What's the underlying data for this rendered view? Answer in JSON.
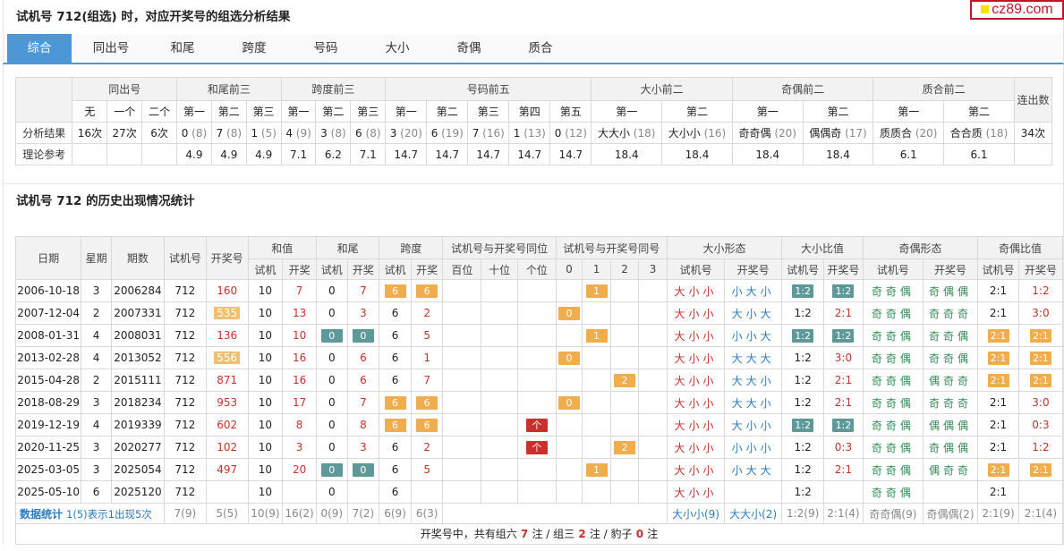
{
  "logo": "cz89.com",
  "section1_title": "试机号 712(组选) 时，对应开奖号的组选分析结果",
  "tabs": [
    "综合",
    "同出号",
    "和尾",
    "跨度",
    "号码",
    "大小",
    "奇偶",
    "质合"
  ],
  "analysis": {
    "groups": [
      "同出号",
      "和尾前三",
      "跨度前三",
      "号码前五",
      "大小前二",
      "奇偶前二",
      "质合前二"
    ],
    "last_col": "连出数",
    "sub": [
      "无",
      "一个",
      "二个",
      "第一",
      "第二",
      "第三",
      "第一",
      "第二",
      "第三",
      "第一",
      "第二",
      "第三",
      "第四",
      "第五",
      "第一",
      "第二",
      "第一",
      "第二",
      "第一",
      "第二"
    ],
    "row1_label": "分析结果",
    "row1": [
      [
        "16次",
        ""
      ],
      [
        "27次",
        ""
      ],
      [
        "6次",
        ""
      ],
      [
        "0",
        "8"
      ],
      [
        "7",
        "8"
      ],
      [
        "1",
        "5"
      ],
      [
        "4",
        "9"
      ],
      [
        "3",
        "8"
      ],
      [
        "6",
        "8"
      ],
      [
        "3",
        "20"
      ],
      [
        "6",
        "19"
      ],
      [
        "7",
        "16"
      ],
      [
        "1",
        "13"
      ],
      [
        "0",
        "12"
      ],
      [
        "大大小",
        "18"
      ],
      [
        "大小小",
        "16"
      ],
      [
        "奇奇偶",
        "20"
      ],
      [
        "偶偶奇",
        "17"
      ],
      [
        "质质合",
        "20"
      ],
      [
        "合合质",
        "18"
      ]
    ],
    "row1_last": "34次",
    "row2_label": "理论参考",
    "row2": [
      "",
      "",
      "",
      "4.9",
      "4.9",
      "4.9",
      "7.1",
      "6.2",
      "7.1",
      "14.7",
      "14.7",
      "14.7",
      "14.7",
      "14.7",
      "18.4",
      "18.4",
      "18.4",
      "18.4",
      "6.1",
      "6.1"
    ],
    "row2_last": ""
  },
  "section2_title": "试机号 712 的历史出现情况统计",
  "history": {
    "top_headers": [
      "日期",
      "星期",
      "期数",
      "试机号",
      "开奖号",
      "和值",
      "和尾",
      "跨度",
      "试机号与开奖号同位",
      "试机号与开奖号同号",
      "大小形态",
      "大小比值",
      "奇偶形态",
      "奇偶比值"
    ],
    "sub_headers": [
      "试机",
      "开奖",
      "试机",
      "开奖",
      "试机",
      "开奖",
      "百位",
      "十位",
      "个位",
      "0",
      "1",
      "2",
      "3",
      "试机号",
      "开奖号",
      "试机号",
      "开奖号",
      "试机号",
      "开奖号",
      "试机号",
      "开奖号"
    ],
    "rows": [
      {
        "date": "2006-10-18",
        "wk": "3",
        "qs": "2006284",
        "sj": "712",
        "kj": "160",
        "kjm": false,
        "hz1": "10",
        "hz2": "7",
        "hw1": "0",
        "hw1m": false,
        "hw2": "7",
        "hw2m": false,
        "kd1": "6",
        "kd1m": true,
        "kd2": "6",
        "kd2m": true,
        "tw": [
          "",
          "",
          ""
        ],
        "th": [
          "",
          "1",
          "",
          ""
        ],
        "dx1": "大小小",
        "dx2": "小大小",
        "bl1": "1:2",
        "bl1m": true,
        "bl2": "1:2",
        "bl2m": true,
        "jo1": "奇奇偶",
        "jo2": "奇偶偶",
        "jb1": "2:1",
        "jb1m": false,
        "jb2": "1:2",
        "jb2m": false
      },
      {
        "date": "2007-12-04",
        "wk": "2",
        "qs": "2007331",
        "sj": "712",
        "kj": "535",
        "kjm": true,
        "hz1": "10",
        "hz2": "13",
        "hw1": "0",
        "hw1m": false,
        "hw2": "3",
        "hw2m": false,
        "kd1": "6",
        "kd1m": false,
        "kd2": "2",
        "kd2m": false,
        "tw": [
          "",
          "",
          ""
        ],
        "th": [
          "0",
          "",
          "",
          ""
        ],
        "dx1": "大小小",
        "dx2": "大小大",
        "bl1": "1:2",
        "bl1m": false,
        "bl2": "2:1",
        "bl2m": false,
        "jo1": "奇奇偶",
        "jo2": "奇奇奇",
        "jb1": "2:1",
        "jb1m": false,
        "jb2": "3:0",
        "jb2m": false
      },
      {
        "date": "2008-01-31",
        "wk": "4",
        "qs": "2008031",
        "sj": "712",
        "kj": "136",
        "kjm": false,
        "hz1": "10",
        "hz2": "10",
        "hw1": "0",
        "hw1m": true,
        "hw2": "0",
        "hw2m": true,
        "kd1": "6",
        "kd1m": false,
        "kd2": "5",
        "kd2m": false,
        "tw": [
          "",
          "",
          ""
        ],
        "th": [
          "",
          "1",
          "",
          ""
        ],
        "dx1": "大小小",
        "dx2": "小小大",
        "bl1": "1:2",
        "bl1m": true,
        "bl2": "1:2",
        "bl2m": true,
        "jo1": "奇奇偶",
        "jo2": "奇奇偶",
        "jb1": "2:1",
        "jb1m": true,
        "jb2": "2:1",
        "jb2m": true
      },
      {
        "date": "2013-02-28",
        "wk": "4",
        "qs": "2013052",
        "sj": "712",
        "kj": "556",
        "kjm": true,
        "hz1": "10",
        "hz2": "16",
        "hw1": "0",
        "hw1m": false,
        "hw2": "6",
        "hw2m": false,
        "kd1": "6",
        "kd1m": false,
        "kd2": "1",
        "kd2m": false,
        "tw": [
          "",
          "",
          ""
        ],
        "th": [
          "0",
          "",
          "",
          ""
        ],
        "dx1": "大小小",
        "dx2": "大大大",
        "bl1": "1:2",
        "bl1m": false,
        "bl2": "3:0",
        "bl2m": false,
        "jo1": "奇奇偶",
        "jo2": "奇奇偶",
        "jb1": "2:1",
        "jb1m": true,
        "jb2": "2:1",
        "jb2m": true
      },
      {
        "date": "2015-04-28",
        "wk": "2",
        "qs": "2015111",
        "sj": "712",
        "kj": "871",
        "kjm": false,
        "hz1": "10",
        "hz2": "16",
        "hw1": "0",
        "hw1m": false,
        "hw2": "6",
        "hw2m": false,
        "kd1": "6",
        "kd1m": false,
        "kd2": "7",
        "kd2m": false,
        "tw": [
          "",
          "",
          ""
        ],
        "th": [
          "",
          "",
          "2",
          ""
        ],
        "dx1": "大小小",
        "dx2": "大大小",
        "bl1": "1:2",
        "bl1m": false,
        "bl2": "2:1",
        "bl2m": false,
        "jo1": "奇奇偶",
        "jo2": "偶奇奇",
        "jb1": "2:1",
        "jb1m": true,
        "jb2": "2:1",
        "jb2m": true
      },
      {
        "date": "2018-08-29",
        "wk": "3",
        "qs": "2018234",
        "sj": "712",
        "kj": "953",
        "kjm": false,
        "hz1": "10",
        "hz2": "17",
        "hw1": "0",
        "hw1m": false,
        "hw2": "7",
        "hw2m": false,
        "kd1": "6",
        "kd1m": true,
        "kd2": "6",
        "kd2m": true,
        "tw": [
          "",
          "",
          ""
        ],
        "th": [
          "0",
          "",
          "",
          ""
        ],
        "dx1": "大小小",
        "dx2": "大大小",
        "bl1": "1:2",
        "bl1m": false,
        "bl2": "2:1",
        "bl2m": false,
        "jo1": "奇奇偶",
        "jo2": "奇奇奇",
        "jb1": "2:1",
        "jb1m": false,
        "jb2": "3:0",
        "jb2m": false
      },
      {
        "date": "2019-12-19",
        "wk": "4",
        "qs": "2019339",
        "sj": "712",
        "kj": "602",
        "kjm": false,
        "hz1": "10",
        "hz2": "8",
        "hw1": "0",
        "hw1m": false,
        "hw2": "8",
        "hw2m": false,
        "kd1": "6",
        "kd1m": true,
        "kd2": "6",
        "kd2m": true,
        "tw": [
          "",
          "",
          "个"
        ],
        "th": [
          "",
          "",
          "",
          ""
        ],
        "dx1": "大小小",
        "dx2": "大小小",
        "bl1": "1:2",
        "bl1m": true,
        "bl2": "1:2",
        "bl2m": true,
        "jo1": "奇奇偶",
        "jo2": "偶偶偶",
        "jb1": "2:1",
        "jb1m": false,
        "jb2": "0:3",
        "jb2m": false
      },
      {
        "date": "2020-11-25",
        "wk": "3",
        "qs": "2020277",
        "sj": "712",
        "kj": "102",
        "kjm": false,
        "hz1": "10",
        "hz2": "3",
        "hw1": "0",
        "hw1m": false,
        "hw2": "3",
        "hw2m": false,
        "kd1": "6",
        "kd1m": false,
        "kd2": "2",
        "kd2m": false,
        "tw": [
          "",
          "",
          "个"
        ],
        "th": [
          "",
          "",
          "2",
          ""
        ],
        "dx1": "大小小",
        "dx2": "小小小",
        "bl1": "1:2",
        "bl1m": false,
        "bl2": "0:3",
        "bl2m": false,
        "jo1": "奇奇偶",
        "jo2": "奇偶偶",
        "jb1": "2:1",
        "jb1m": false,
        "jb2": "1:2",
        "jb2m": false
      },
      {
        "date": "2025-03-05",
        "wk": "3",
        "qs": "2025054",
        "sj": "712",
        "kj": "497",
        "kjm": false,
        "hz1": "10",
        "hz2": "20",
        "hw1": "0",
        "hw1m": true,
        "hw2": "0",
        "hw2m": true,
        "kd1": "6",
        "kd1m": false,
        "kd2": "5",
        "kd2m": false,
        "tw": [
          "",
          "",
          ""
        ],
        "th": [
          "",
          "1",
          "",
          ""
        ],
        "dx1": "大小小",
        "dx2": "小大大",
        "bl1": "1:2",
        "bl1m": false,
        "bl2": "2:1",
        "bl2m": false,
        "jo1": "奇奇偶",
        "jo2": "偶奇奇",
        "jb1": "2:1",
        "jb1m": true,
        "jb2": "2:1",
        "jb2m": true
      },
      {
        "date": "2025-05-10",
        "wk": "6",
        "qs": "2025120",
        "sj": "712",
        "kj": "",
        "kjm": false,
        "hz1": "10",
        "hz2": "",
        "hw1": "0",
        "hw1m": false,
        "hw2": "",
        "hw2m": false,
        "kd1": "6",
        "kd1m": false,
        "kd2": "",
        "kd2m": false,
        "tw": [
          "",
          "",
          ""
        ],
        "th": [
          "",
          "",
          "",
          ""
        ],
        "dx1": "大小小",
        "dx2": "",
        "bl1": "1:2",
        "bl1m": false,
        "bl2": "",
        "bl2m": false,
        "jo1": "奇奇偶",
        "jo2": "",
        "jb1": "2:1",
        "jb1m": false,
        "jb2": "",
        "jb2m": false
      }
    ],
    "stat": {
      "label": "数据统计",
      "note": "1(5)表示1出现5次",
      "sj": "7(9)",
      "kj": "5(5)",
      "hz1": "10(9)",
      "hz2": "16(2)",
      "hw1": "0(9)",
      "hw2": "7(2)",
      "kd1": "6(9)",
      "kd2": "6(3)",
      "dx1": "大小小(9)",
      "dx2": "大大小(2)",
      "bl1": "1:2(9)",
      "bl2": "2:1(4)",
      "jo1": "奇奇偶(9)",
      "jo2": "奇偶偶(2)",
      "jb1": "2:1(9)",
      "jb2": "2:1(4)"
    },
    "footer": {
      "pre": "开奖号中，共有组六",
      "n6": "7",
      "mid1": "注 / 组三",
      "n3": "2",
      "mid2": "注 / 豹子",
      "nb": "0",
      "post": "注"
    }
  }
}
